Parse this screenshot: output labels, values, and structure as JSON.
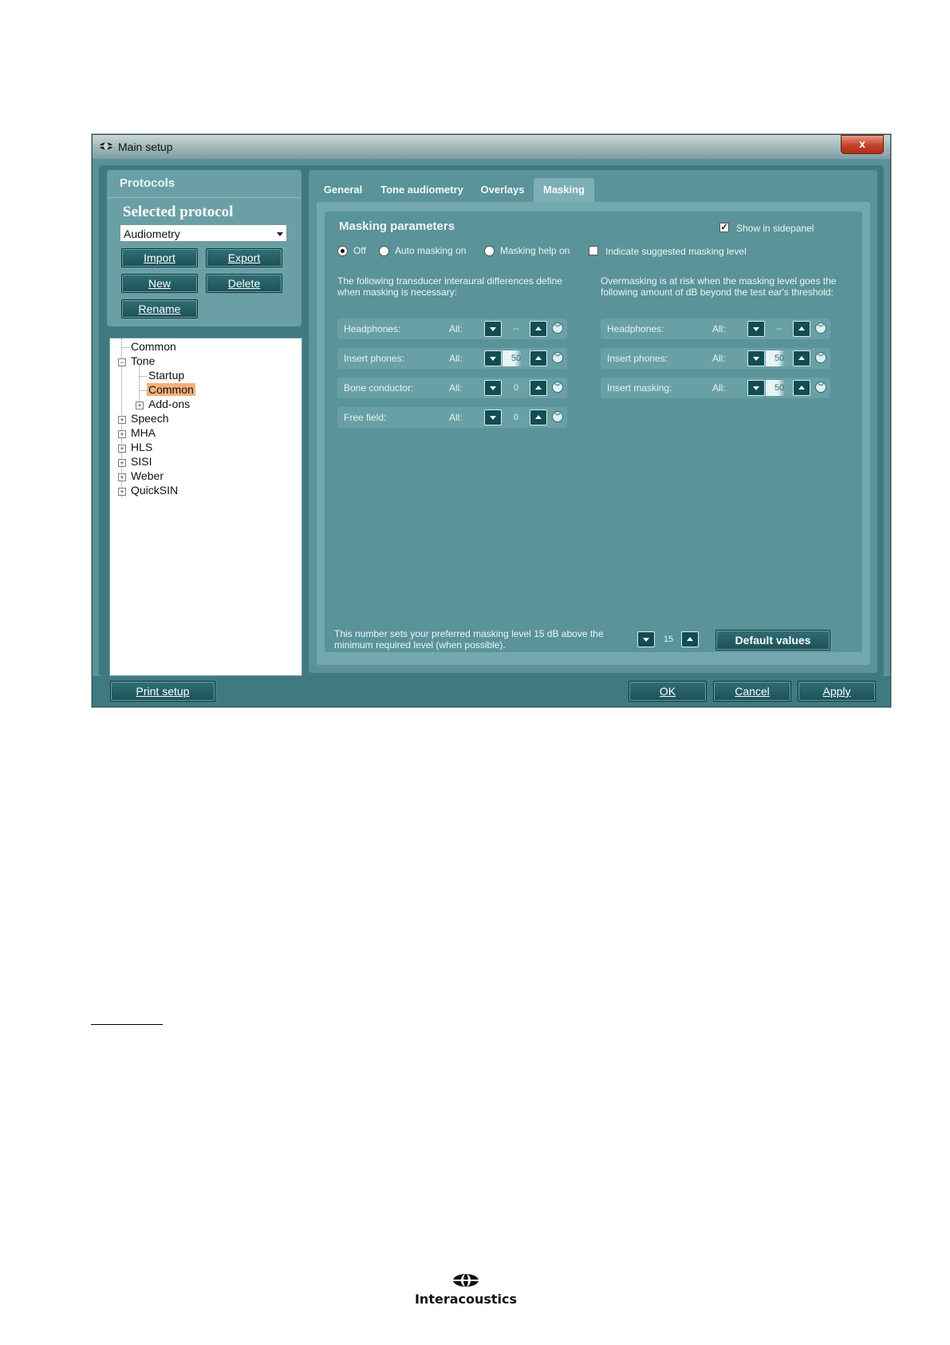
{
  "window": {
    "title": "Main setup",
    "close_label": "x"
  },
  "protocols": {
    "header": "Protocols",
    "selected_label": "Selected protocol",
    "selected_value": "Audiometry",
    "buttons": {
      "import": "Import",
      "export": "Export",
      "new": "New",
      "delete": "Delete",
      "rename": "Rename"
    }
  },
  "tree": {
    "items": [
      "Common",
      "Tone",
      "Startup",
      "Common",
      "Add-ons",
      "Speech",
      "MHA",
      "HLS",
      "SISI",
      "Weber",
      "QuickSIN"
    ],
    "selected": "Common"
  },
  "tabs": [
    "General",
    "Tone audiometry",
    "Overlays",
    "Masking"
  ],
  "active_tab": "Masking",
  "masking": {
    "title": "Masking parameters",
    "show_in_sidepanel": "Show in sidepanel",
    "show_in_sidepanel_checked": true,
    "mode_options": [
      "Off",
      "Auto masking on",
      "Masking help on"
    ],
    "mode_selected": "Off",
    "indicate_label": "Indicate suggested masking level",
    "indicate_checked": false,
    "left_desc": "The following transducer interaural differences define when masking is necessary:",
    "right_desc": "Overmasking is at risk when the masking level goes the following amount of dB beyond the test ear's threshold:",
    "all_label": "All:",
    "left_rows": [
      {
        "label": "Headphones:",
        "value": "--"
      },
      {
        "label": "Insert phones:",
        "value": "50"
      },
      {
        "label": "Bone conductor:",
        "value": "0"
      },
      {
        "label": "Free field:",
        "value": "0"
      }
    ],
    "right_rows": [
      {
        "label": "Headphones:",
        "value": "--"
      },
      {
        "label": "Insert phones:",
        "value": "50"
      },
      {
        "label": "Insert masking:",
        "value": "50"
      }
    ],
    "footer_text": "This number sets your preferred masking level 15 dB above the minimum required level (when possible).",
    "footer_value": "15",
    "default_values": "Default values"
  },
  "bottom": {
    "print_setup": "Print setup",
    "ok": "OK",
    "cancel": "Cancel",
    "apply": "Apply"
  },
  "brand": "Interacoustics"
}
